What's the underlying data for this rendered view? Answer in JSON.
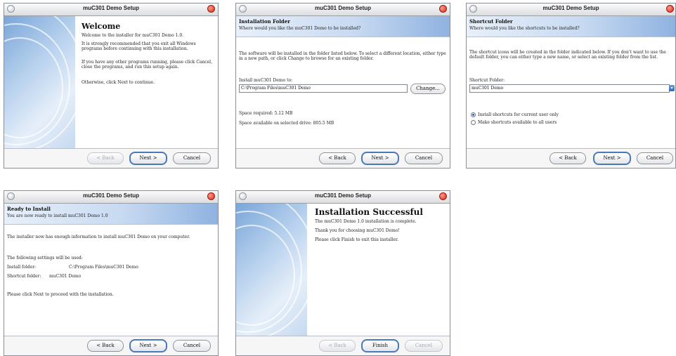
{
  "window_title": "muC301 Demo Setup",
  "buttons": {
    "back": "< Back",
    "next": "Next >",
    "cancel": "Cancel",
    "finish": "Finish"
  },
  "welcome": {
    "heading": "Welcome",
    "line1": "Welcome to the installer for muC301 Demo 1.0.",
    "para2": "It is strongly recommended that you exit all Windows programs before continuing with this installation.",
    "para3": "If you have any other programs running, please click Cancel, close the programs, and run this setup again.",
    "para4": "Otherwise, click Next to continue."
  },
  "folder": {
    "heading": "Installation Folder",
    "subheading": "Where would you like the muC301 Demo to be installed?",
    "description": "The software will be installed in the folder listed below. To select a different location, either type in a new path, or click Change to browse for an existing folder.",
    "install_label": "Install muC301 Demo to:",
    "path": "C:\\Program Files\\muC301 Demo",
    "change_button": "Change...",
    "space_required": "Space required: 5.12 MB",
    "space_available": "Space available on selected drive: 805.5 MB"
  },
  "shortcut": {
    "heading": "Shortcut Folder",
    "subheading": "Where would you like the shortcuts to be installed?",
    "description": "The shortcut icons will be created in the folder indicated below. If you don't want to use the default folder, you can either type a new name, or select an existing folder from the list.",
    "folder_label": "Shortcut Folder:",
    "folder_value": "muC301 Demo",
    "option1": "Install shortcuts for current user only",
    "option2": "Make shortcuts available to all users"
  },
  "ready": {
    "heading": "Ready to Install",
    "subheading": "You are now ready to install muC301 Demo 1.0",
    "line1": "The installer now has enough information to install muC301 Demo on your computer.",
    "line2": "The following settings will be used:",
    "install_folder_label": "Install folder:",
    "install_folder_value": "C:\\Program Files\\muC301 Demo",
    "shortcut_folder_label": "Shortcut folder:",
    "shortcut_folder_value": "muC301 Demo",
    "line3": "Please click Next to proceed with the installation."
  },
  "success": {
    "heading": "Installation Successful",
    "line1": "The muC301 Demo 1.0 installation is complete.",
    "line2": "Thank you for choosing muC301 Demo!",
    "line3": "Please click Finish to exit this installer."
  }
}
